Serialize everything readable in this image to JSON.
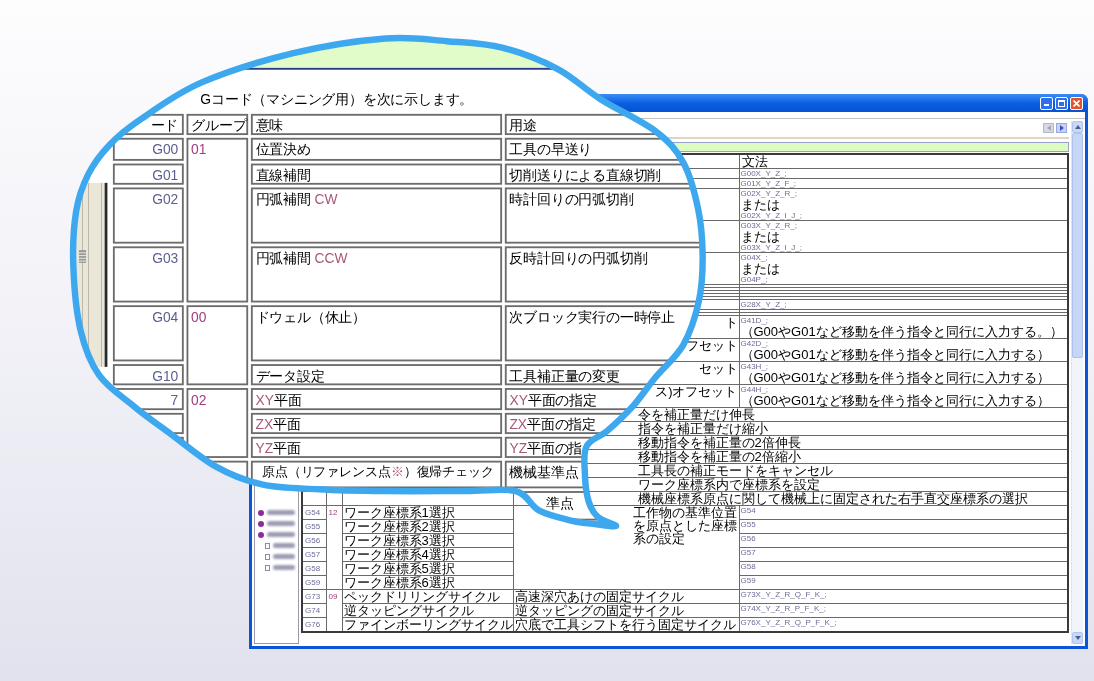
{
  "window": {
    "table": {
      "syntax_heading": "文法",
      "blocks": [
        {
          "rows": [
            {
              "syntax": [
                {
                  "kind": "code",
                  "text": "G00X_Y_Z_;"
                }
              ]
            },
            {
              "syntax": [
                {
                  "kind": "code",
                  "text": "G01X_Y_Z_F_;"
                }
              ]
            },
            {
              "syntax": [
                {
                  "kind": "code",
                  "text": "G02X_Y_Z_R_;"
                },
                {
                  "kind": "text",
                  "text": "または"
                },
                {
                  "kind": "code",
                  "text": "G02X_Y_Z_I_J_;"
                }
              ]
            },
            {
              "syntax": [
                {
                  "kind": "code",
                  "text": "G03X_Y_Z_R_;"
                },
                {
                  "kind": "text",
                  "text": "または"
                },
                {
                  "kind": "code",
                  "text": "G03X_Y_Z_I_J_;"
                }
              ]
            },
            {
              "syntax": [
                {
                  "kind": "code",
                  "text": "G04X_;"
                },
                {
                  "kind": "text",
                  "text": "または"
                },
                {
                  "kind": "code",
                  "text": "G04P_;"
                }
              ]
            },
            {},
            {},
            {},
            {},
            {},
            {
              "syntax": [
                {
                  "kind": "code",
                  "text": "G28X_Y_Z_;"
                }
              ]
            },
            {},
            {},
            {
              "usage": "ト",
              "syntax": [
                {
                  "kind": "code",
                  "text": "G41D_;"
                },
                {
                  "kind": "text",
                  "text": "（G00やG01など移動を伴う指令と同行に入力する。）"
                }
              ]
            },
            {
              "usage": "フセット",
              "syntax": [
                {
                  "kind": "code",
                  "text": "G42D_;"
                },
                {
                  "kind": "text",
                  "text": "（G00やG01など移動を伴う指令と同行に入力する）"
                }
              ]
            },
            {
              "usage": "セット",
              "syntax": [
                {
                  "kind": "code",
                  "text": "G43H_;"
                },
                {
                  "kind": "text",
                  "text": "（G00やG01など移動を伴う指令と同行に入力する）"
                }
              ]
            },
            {
              "usage": "ス)オフセット",
              "syntax": [
                {
                  "kind": "code",
                  "text": "G44H_;"
                },
                {
                  "kind": "text",
                  "text": "（G00やG01など移動を伴う指令と同行に入力する）"
                }
              ]
            },
            {
              "usage": "令を補正量だけ伸長"
            },
            {
              "usage": "指令を補正量だけ縮小"
            },
            {
              "usage": "移動指令を補正量の2倍伸長"
            },
            {
              "usage": "移動指令を補正量の2倍縮小"
            },
            {
              "usage": "工具長の補正モードをキャンセル"
            },
            {
              "usage": "ワーク座標系内で座標系を設定"
            },
            {
              "usage": "機械座標系原点に関して機械上に固定された右手直交座標系の選択"
            }
          ]
        },
        {
          "group": "12",
          "usage": "工作物の基準位置を原点とした座標系の設定",
          "rows": [
            {
              "code": "G54",
              "meaning": "ワーク座標系1選択",
              "syntax": [
                {
                  "kind": "code",
                  "text": "G54"
                }
              ]
            },
            {
              "code": "G55",
              "meaning": "ワーク座標系2選択",
              "syntax": [
                {
                  "kind": "code",
                  "text": "G55"
                }
              ]
            },
            {
              "code": "G56",
              "meaning": "ワーク座標系3選択",
              "syntax": [
                {
                  "kind": "code",
                  "text": "G56"
                }
              ]
            },
            {
              "code": "G57",
              "meaning": "ワーク座標系4選択",
              "syntax": [
                {
                  "kind": "code",
                  "text": "G57"
                }
              ]
            },
            {
              "code": "G58",
              "meaning": "ワーク座標系5選択",
              "syntax": [
                {
                  "kind": "code",
                  "text": "G58"
                }
              ]
            },
            {
              "code": "G59",
              "meaning": "ワーク座標系6選択",
              "syntax": [
                {
                  "kind": "code",
                  "text": "G59"
                }
              ]
            }
          ]
        },
        {
          "group": "09",
          "rows": [
            {
              "code": "G73",
              "meaning": "ペックドリリングサイクル",
              "usage": "高速深穴あけの固定サイクル",
              "syntax": [
                {
                  "kind": "code",
                  "text": "G73X_Y_Z_R_Q_F_K_;"
                }
              ]
            },
            {
              "code": "G74",
              "meaning": "逆タッピングサイクル",
              "usage": "逆タッピングの固定サイクル",
              "syntax": [
                {
                  "kind": "code",
                  "text": "G74X_Y_Z_R_P_F_K_;"
                }
              ]
            },
            {
              "code": "G76",
              "meaning": "ファインボーリングサイクル",
              "usage": "穴底で工具シフトを行う固定サイクル",
              "syntax": [
                {
                  "kind": "code",
                  "text": "G76X_Y_Z_R_Q_P_F_K_;"
                }
              ]
            }
          ]
        }
      ]
    }
  },
  "magnifier": {
    "intro": "Gコード（マシニング用）を次に示します。",
    "columns": [
      "ード",
      "グループ",
      "意味",
      "用途"
    ],
    "blocks": [
      {
        "group": "01",
        "rows": [
          {
            "code": "G00",
            "meaning": "位置決め",
            "usage": "工具の早送り"
          },
          {
            "code": "G01",
            "meaning": "直線補間",
            "usage": "切削送りによる直線切削"
          },
          {
            "code": "G02",
            "meaning": [
              {
                "text": "円弧補間 ",
                "accent": false
              },
              {
                "text": "CW",
                "accent": true
              }
            ],
            "usage": "時計回りの円弧切削"
          },
          {
            "code": "G03",
            "meaning": [
              {
                "text": "円弧補間 ",
                "accent": false
              },
              {
                "text": "CCW",
                "accent": true
              }
            ],
            "usage": "反時計回りの円弧切削"
          }
        ]
      },
      {
        "group": "00",
        "rows": [
          {
            "code": "G04",
            "meaning": "ドウェル（休止）",
            "usage": "次ブロック実行の一時停止"
          },
          {
            "code": "G10",
            "meaning": "データ設定",
            "usage": "工具補正量の変更"
          }
        ]
      },
      {
        "group": "02",
        "rows": [
          {
            "code": "7",
            "meaning": [
              {
                "text": "XY",
                "accent": true
              },
              {
                "text": "平面",
                "accent": false
              }
            ],
            "usage": [
              {
                "text": "XY",
                "accent": true
              },
              {
                "text": "平面の指定",
                "accent": false
              }
            ]
          },
          {
            "meaning": [
              {
                "text": "ZX",
                "accent": true
              },
              {
                "text": "平面",
                "accent": false
              }
            ],
            "usage": [
              {
                "text": "ZX",
                "accent": true
              },
              {
                "text": "平面の指定",
                "accent": false
              }
            ]
          },
          {
            "meaning": [
              {
                "text": "YZ",
                "accent": true
              },
              {
                "text": "平面",
                "accent": false
              }
            ],
            "usage": [
              {
                "text": "YZ",
                "accent": true
              },
              {
                "text": "平面の指",
                "accent": false
              }
            ]
          }
        ]
      },
      {
        "rows": [
          {
            "meaning": [
              {
                "text": "原点（リファレンス点",
                "accent": false
              },
              {
                "text": "※",
                "accent": true
              },
              {
                "text": "）復帰チェック",
                "accent": false
              }
            ],
            "usage": "機械基準点"
          },
          {
            "usage": "準点"
          }
        ]
      }
    ]
  }
}
